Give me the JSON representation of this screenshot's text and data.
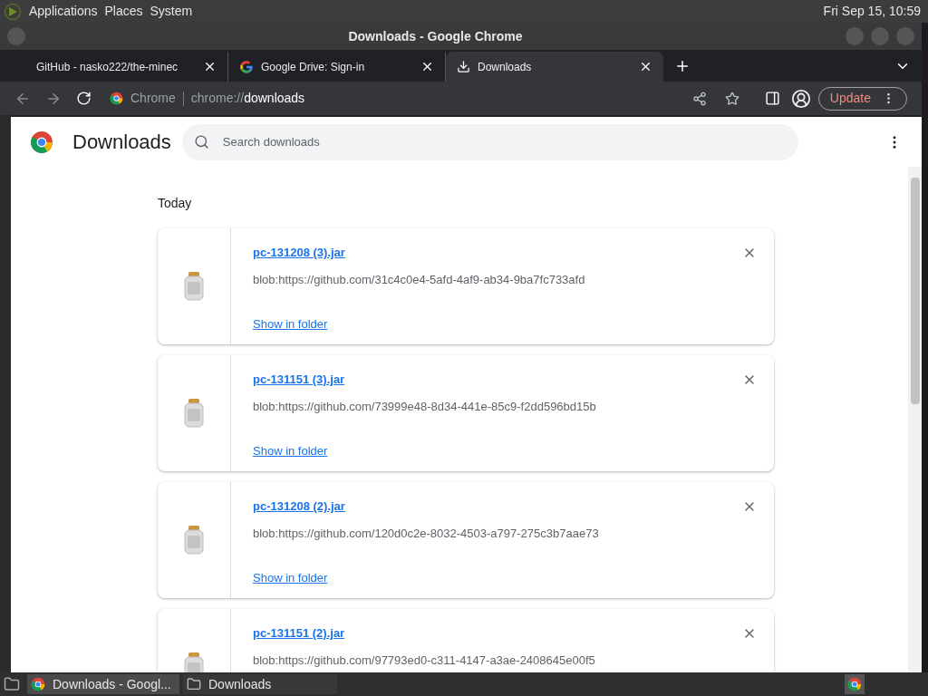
{
  "top_panel": {
    "menus": [
      "Applications",
      "Places",
      "System"
    ],
    "clock": "Fri Sep 15, 10:59"
  },
  "window": {
    "title": "Downloads - Google Chrome"
  },
  "tabs": [
    {
      "label": "GitHub - nasko222/the-minec",
      "kind": "plain",
      "selected": false
    },
    {
      "label": "Google Drive: Sign-in",
      "kind": "google",
      "selected": false
    },
    {
      "label": "Downloads",
      "kind": "download",
      "selected": true
    }
  ],
  "omnibox": {
    "chip": "Chrome",
    "url_prefix": "chrome://",
    "url_path": "downloads"
  },
  "update_button": "Update",
  "page": {
    "title": "Downloads",
    "search": {
      "placeholder": "Search downloads"
    },
    "section": "Today",
    "downloads": [
      {
        "name": "pc-131208 (3).jar",
        "url": "blob:https://github.com/31c4c0e4-5afd-4af9-ab34-9ba7fc733afd",
        "action": "Show in folder"
      },
      {
        "name": "pc-131151 (3).jar",
        "url": "blob:https://github.com/73999e48-8d34-441e-85c9-f2dd596bd15b",
        "action": "Show in folder"
      },
      {
        "name": "pc-131208 (2).jar",
        "url": "blob:https://github.com/120d0c2e-8032-4503-a797-275c3b7aae73",
        "action": "Show in folder"
      },
      {
        "name": "pc-131151 (2).jar",
        "url": "blob:https://github.com/97793ed0-c311-4147-a3ae-2408645e00f5"
      }
    ]
  },
  "taskbar": {
    "items": [
      {
        "label": "Downloads - Googl...",
        "kind": "browser",
        "selected": true
      },
      {
        "label": "Downloads",
        "kind": "folder",
        "selected": false
      }
    ]
  }
}
